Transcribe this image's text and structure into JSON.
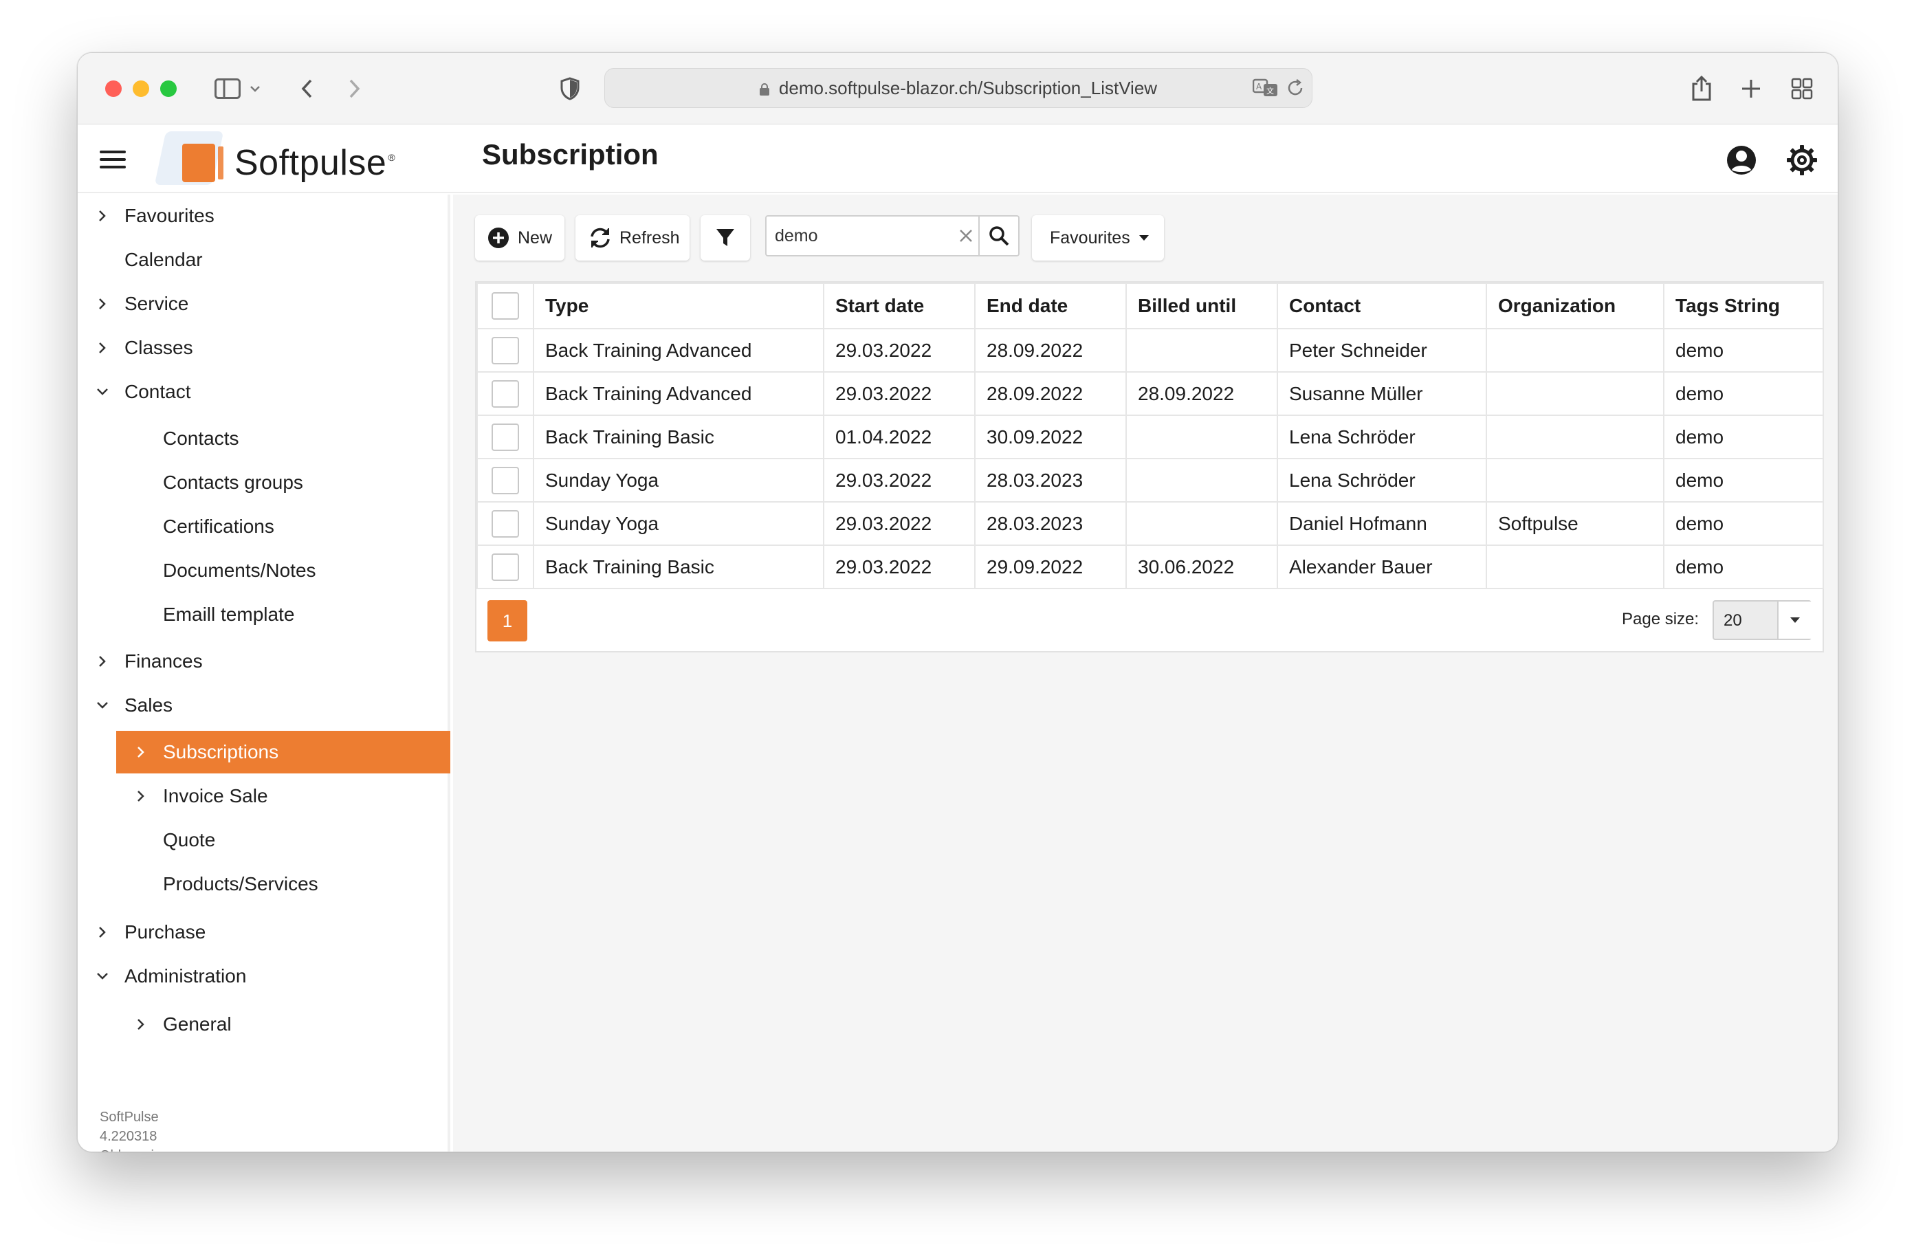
{
  "browser": {
    "url": "demo.softpulse-blazor.ch/Subscription_ListView"
  },
  "header": {
    "logo_text": "Softpulse",
    "logo_reg": "®",
    "page_title": "Subscription"
  },
  "sidebar": {
    "items": [
      {
        "label": "Favourites",
        "chevron": "right"
      },
      {
        "label": "Calendar",
        "chevron": "none"
      },
      {
        "label": "Service",
        "chevron": "right"
      },
      {
        "label": "Classes",
        "chevron": "right"
      },
      {
        "label": "Contact",
        "chevron": "down"
      },
      {
        "label": "Contacts",
        "chevron": "none"
      },
      {
        "label": "Contacts groups",
        "chevron": "none"
      },
      {
        "label": "Certifications",
        "chevron": "none"
      },
      {
        "label": "Documents/Notes",
        "chevron": "none"
      },
      {
        "label": "Emaill template",
        "chevron": "none"
      },
      {
        "label": "Finances",
        "chevron": "right"
      },
      {
        "label": "Sales",
        "chevron": "down"
      },
      {
        "label": "Subscriptions",
        "chevron": "right",
        "active": true
      },
      {
        "label": "Invoice Sale",
        "chevron": "right"
      },
      {
        "label": "Quote",
        "chevron": "none"
      },
      {
        "label": "Products/Services",
        "chevron": "none"
      },
      {
        "label": "Purchase",
        "chevron": "right"
      },
      {
        "label": "Administration",
        "chevron": "down"
      },
      {
        "label": "General",
        "chevron": "right"
      }
    ],
    "footer": {
      "product": "SoftPulse",
      "version": "4.220318",
      "old_version": "Old version"
    }
  },
  "toolbar": {
    "new_label": "New",
    "refresh_label": "Refresh",
    "search_value": "demo",
    "favourites_label": "Favourites"
  },
  "grid": {
    "columns": [
      "Type",
      "Start date",
      "End date",
      "Billed until",
      "Contact",
      "Organization",
      "Tags String"
    ],
    "rows": [
      [
        "Back Training Advanced",
        "29.03.2022",
        "28.09.2022",
        "",
        "Peter Schneider",
        "",
        "demo"
      ],
      [
        "Back Training Advanced",
        "29.03.2022",
        "28.09.2022",
        "28.09.2022",
        "Susanne Müller",
        "",
        "demo"
      ],
      [
        "Back Training Basic",
        "01.04.2022",
        "30.09.2022",
        "",
        "Lena Schröder",
        "",
        "demo"
      ],
      [
        "Sunday Yoga",
        "29.03.2022",
        "28.03.2023",
        "",
        "Lena Schröder",
        "",
        "demo"
      ],
      [
        "Sunday Yoga",
        "29.03.2022",
        "28.03.2023",
        "",
        "Daniel Hofmann",
        "Softpulse",
        "demo"
      ],
      [
        "Back Training Basic",
        "29.03.2022",
        "29.09.2022",
        "30.06.2022",
        "Alexander Bauer",
        "",
        "demo"
      ]
    ]
  },
  "pager": {
    "current_page": "1",
    "page_size_label": "Page size:",
    "page_size_value": "20"
  },
  "colors": {
    "accent": "#ed7d31"
  }
}
